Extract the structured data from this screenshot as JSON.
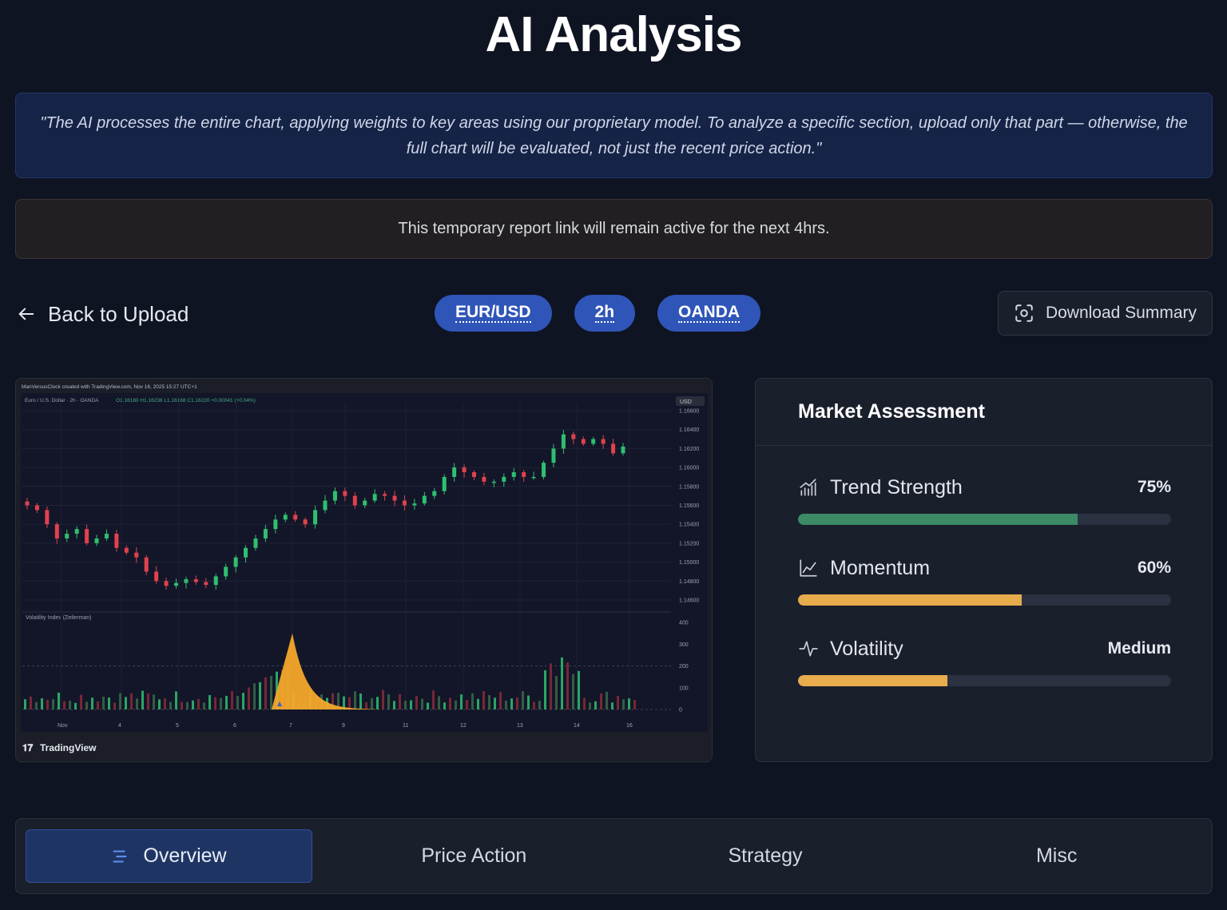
{
  "page": {
    "title": "AI Analysis"
  },
  "quote": {
    "text": "\"The AI processes the entire chart, applying weights to key areas using our proprietary model. To analyze a specific section, upload only that part — otherwise, the full chart will be evaluated, not just the recent price action.\""
  },
  "notice": {
    "text": "This temporary report link will remain active for the next 4hrs."
  },
  "toolbar": {
    "back_label": "Back to Upload",
    "chips": [
      "EUR/USD",
      "2h",
      "OANDA"
    ],
    "download_label": "Download Summary"
  },
  "chart_image": {
    "header_text": "ManVersusClock created with TradingView.com, Nov 16, 2025 15:27 UTC+1",
    "legend_text": "Euro / U.S. Dollar · 2h · OANDA",
    "ohlc": "O1.16180  H1.16236  L1.16168  C1.16220  +0.00041 (+0.04%)",
    "currency": "USD",
    "indicator_label": "Volatility Index (Zeilerman)",
    "watermark": "TradingView"
  },
  "chart_data": {
    "type": "candlestick",
    "price_axis_ticks": [
      "1.16600",
      "1.16400",
      "1.16200",
      "1.16000",
      "1.15800",
      "1.15600",
      "1.15400",
      "1.15200",
      "1.15000",
      "1.14800",
      "1.14600"
    ],
    "indicator_axis_ticks": [
      "400",
      "300",
      "200",
      "100",
      "0"
    ],
    "x_tick_labels": [
      "Nov",
      "4",
      "5",
      "6",
      "7",
      "9",
      "11",
      "12",
      "13",
      "14",
      "16"
    ],
    "close_series": [
      1.156,
      1.1555,
      1.154,
      1.1525,
      1.153,
      1.1535,
      1.152,
      1.1525,
      1.153,
      1.1515,
      1.151,
      1.1505,
      1.149,
      1.148,
      1.1475,
      1.1478,
      1.1482,
      1.1479,
      1.1476,
      1.1485,
      1.1495,
      1.1505,
      1.1515,
      1.1525,
      1.1535,
      1.1545,
      1.155,
      1.1545,
      1.154,
      1.1555,
      1.1565,
      1.1575,
      1.157,
      1.156,
      1.1565,
      1.1572,
      1.157,
      1.1565,
      1.156,
      1.1562,
      1.157,
      1.1575,
      1.159,
      1.16,
      1.1595,
      1.159,
      1.1585,
      1.1585,
      1.159,
      1.1595,
      1.159,
      1.159,
      1.1605,
      1.162,
      1.1635,
      1.163,
      1.1625,
      1.163,
      1.1625,
      1.1615,
      1.1622
    ]
  },
  "market": {
    "title": "Market Assessment",
    "metrics": [
      {
        "name": "Trend Strength",
        "value": "75%",
        "level": 0.75,
        "color": "#3c8a66",
        "icon": "bar-chart-icon"
      },
      {
        "name": "Momentum",
        "value": "60%",
        "level": 0.6,
        "color": "#e8ac4c",
        "icon": "line-chart-icon"
      },
      {
        "name": "Volatility",
        "value": "Medium",
        "level": 0.4,
        "color": "#e8ac4c",
        "icon": "pulse-icon"
      }
    ]
  },
  "tabs": [
    {
      "label": "Overview",
      "active": true
    },
    {
      "label": "Price Action",
      "active": false
    },
    {
      "label": "Strategy",
      "active": false
    },
    {
      "label": "Misc",
      "active": false
    }
  ]
}
